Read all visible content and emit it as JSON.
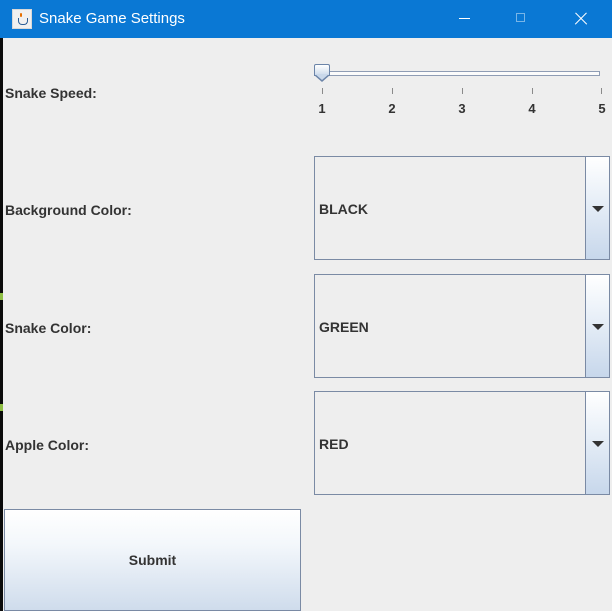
{
  "window": {
    "title": "Snake Game Settings"
  },
  "form": {
    "speed": {
      "label": "Snake Speed:",
      "value": 1,
      "min": 1,
      "max": 5,
      "ticks": [
        "1",
        "2",
        "3",
        "4",
        "5"
      ]
    },
    "background": {
      "label": "Background Color:",
      "selected": "BLACK"
    },
    "snake": {
      "label": "Snake Color:",
      "selected": "GREEN"
    },
    "apple": {
      "label": "Apple Color:",
      "selected": "RED"
    },
    "submit_label": "Submit"
  },
  "icons": {
    "app": "java-app-icon",
    "minimize": "minimize-icon",
    "maximize": "maximize-icon",
    "close": "close-icon",
    "dropdown": "chevron-down-icon"
  },
  "colors": {
    "titlebar": "#0a78d4",
    "window_bg": "#eeeeee",
    "text": "#333333",
    "border": "#7a8aa4"
  }
}
